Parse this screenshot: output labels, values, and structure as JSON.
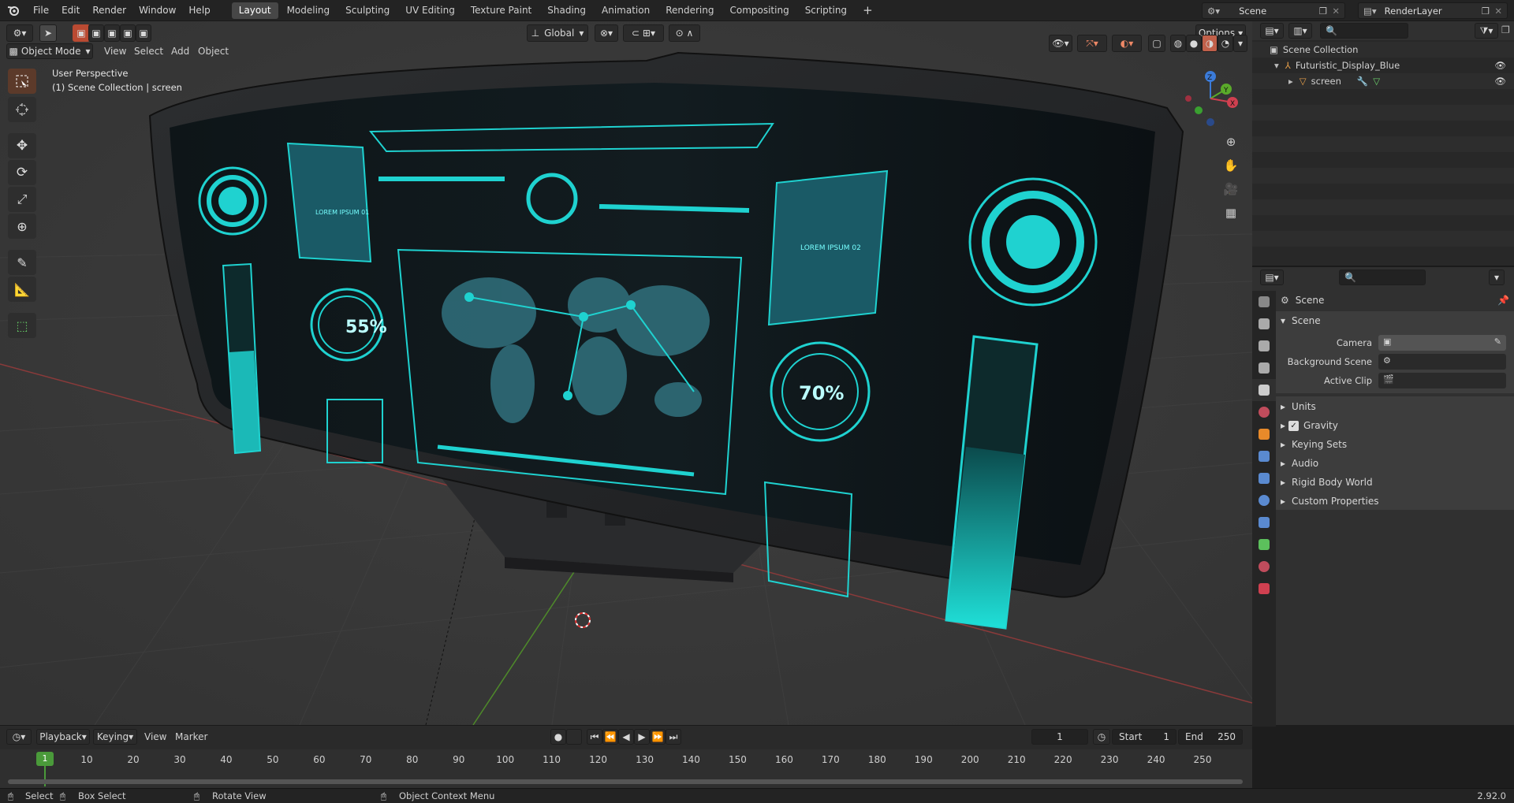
{
  "menu": {
    "items": [
      "File",
      "Edit",
      "Render",
      "Window",
      "Help"
    ]
  },
  "workspaces": [
    "Layout",
    "Modeling",
    "Sculpting",
    "UV Editing",
    "Texture Paint",
    "Shading",
    "Animation",
    "Rendering",
    "Compositing",
    "Scripting"
  ],
  "active_workspace": "Layout",
  "scene_name": "Scene",
  "render_layer": "RenderLayer",
  "viewport": {
    "mode": "Object Mode",
    "menus": [
      "View",
      "Select",
      "Add",
      "Object"
    ],
    "orientation": "Global",
    "options": "Options",
    "perspective": "User Perspective",
    "collection_info": "(1) Scene Collection | screen",
    "gizmo_axes": [
      "Z",
      "Y",
      "X"
    ]
  },
  "screen_texture": {
    "pct_left": "55%",
    "pct_right": "70%",
    "card_1": "LOREM IPSUM 01",
    "card_2": "LOREM IPSUM 02"
  },
  "outliner": {
    "root": "Scene Collection",
    "items": [
      {
        "label": "Futuristic_Display_Blue"
      },
      {
        "label": "screen"
      }
    ]
  },
  "properties": {
    "header": "Scene",
    "section": "Scene",
    "fields": [
      {
        "label": "Camera"
      },
      {
        "label": "Background Scene"
      },
      {
        "label": "Active Clip"
      }
    ],
    "subpanels": [
      "Units",
      "Gravity",
      "Keying Sets",
      "Audio",
      "Rigid Body World",
      "Custom Properties"
    ],
    "gravity_checked": true
  },
  "timeline": {
    "menus": [
      "Playback",
      "Keying",
      "View",
      "Marker"
    ],
    "current_frame": "1",
    "start_label": "Start",
    "start": "1",
    "end_label": "End",
    "end": "250",
    "ticks": [
      "1",
      "10",
      "20",
      "30",
      "40",
      "50",
      "60",
      "70",
      "80",
      "90",
      "100",
      "110",
      "120",
      "130",
      "140",
      "150",
      "160",
      "170",
      "180",
      "190",
      "200",
      "210",
      "220",
      "230",
      "240",
      "250"
    ]
  },
  "statusbar": {
    "select": "Select",
    "box_select": "Box Select",
    "rotate": "Rotate View",
    "context": "Object Context Menu",
    "version": "2.92.0"
  },
  "colors": {
    "accent": "#e87d0d",
    "cyan": "#1fd2d0",
    "screen_bg": "#10191c"
  }
}
